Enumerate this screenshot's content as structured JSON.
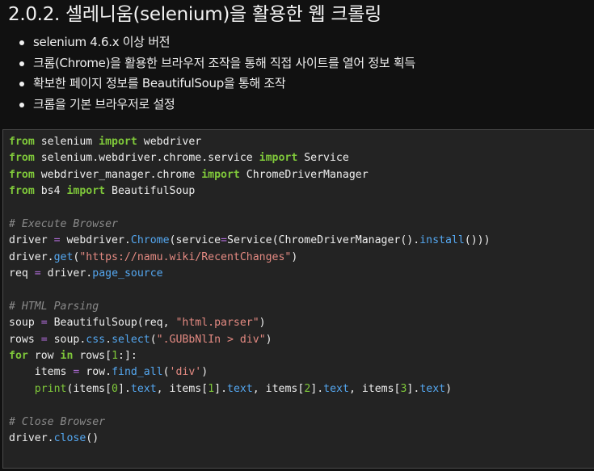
{
  "section": {
    "title": "2.0.2. 셀레니움(selenium)을 활용한 웹 크롤링"
  },
  "bullets": [
    "selenium 4.6.x 이상 버전",
    "크롬(Chrome)을 활용한 브라우저 조작을 통해 직접 사이트를 열어 정보 획득",
    "확보한 페이지 정보를 BeautifulSoup을 통해 조작",
    "크롬을 기본 브라우저로 설정"
  ],
  "code": {
    "language": "python",
    "colors": {
      "background": "#232323",
      "keyword": "#7fc83a",
      "comment": "#8a8a8a",
      "string": "#e48a82",
      "attribute": "#54a7f0",
      "operator": "#b06cd8"
    },
    "lines": [
      [
        {
          "t": "from",
          "c": "kw"
        },
        {
          "t": " selenium "
        },
        {
          "t": "import",
          "c": "kw"
        },
        {
          "t": " webdriver"
        }
      ],
      [
        {
          "t": "from",
          "c": "kw"
        },
        {
          "t": " selenium.webdriver.chrome.service "
        },
        {
          "t": "import",
          "c": "kw"
        },
        {
          "t": " Service"
        }
      ],
      [
        {
          "t": "from",
          "c": "kw"
        },
        {
          "t": " webdriver_manager.chrome "
        },
        {
          "t": "import",
          "c": "kw"
        },
        {
          "t": " ChromeDriverManager"
        }
      ],
      [
        {
          "t": "from",
          "c": "kw"
        },
        {
          "t": " bs4 "
        },
        {
          "t": "import",
          "c": "kw"
        },
        {
          "t": " BeautifulSoup"
        }
      ],
      [],
      [
        {
          "t": "# Execute Browser",
          "c": "cm"
        }
      ],
      [
        {
          "t": "driver "
        },
        {
          "t": "=",
          "c": "op"
        },
        {
          "t": " webdriver."
        },
        {
          "t": "Chrome",
          "c": "at"
        },
        {
          "t": "(service"
        },
        {
          "t": "=",
          "c": "op"
        },
        {
          "t": "Service(ChromeDriverManager()."
        },
        {
          "t": "install",
          "c": "at"
        },
        {
          "t": "()))"
        }
      ],
      [
        {
          "t": "driver."
        },
        {
          "t": "get",
          "c": "at"
        },
        {
          "t": "("
        },
        {
          "t": "\"https://namu.wiki/RecentChanges\"",
          "c": "st"
        },
        {
          "t": ")"
        }
      ],
      [
        {
          "t": "req "
        },
        {
          "t": "=",
          "c": "op"
        },
        {
          "t": " driver."
        },
        {
          "t": "page_source",
          "c": "at"
        }
      ],
      [],
      [
        {
          "t": "# HTML Parsing",
          "c": "cm"
        }
      ],
      [
        {
          "t": "soup "
        },
        {
          "t": "=",
          "c": "op"
        },
        {
          "t": " BeautifulSoup(req, "
        },
        {
          "t": "\"html.parser\"",
          "c": "st"
        },
        {
          "t": ")"
        }
      ],
      [
        {
          "t": "rows "
        },
        {
          "t": "=",
          "c": "op"
        },
        {
          "t": " soup."
        },
        {
          "t": "css",
          "c": "at"
        },
        {
          "t": "."
        },
        {
          "t": "select",
          "c": "at"
        },
        {
          "t": "("
        },
        {
          "t": "\".GUBbNlIn > div\"",
          "c": "st"
        },
        {
          "t": ")"
        }
      ],
      [
        {
          "t": "for",
          "c": "kw"
        },
        {
          "t": " row "
        },
        {
          "t": "in",
          "c": "kw"
        },
        {
          "t": " rows["
        },
        {
          "t": "1",
          "c": "nm"
        },
        {
          "t": ":]:"
        }
      ],
      [
        {
          "t": "    items "
        },
        {
          "t": "=",
          "c": "op"
        },
        {
          "t": " row."
        },
        {
          "t": "find_all",
          "c": "at"
        },
        {
          "t": "("
        },
        {
          "t": "'div'",
          "c": "st"
        },
        {
          "t": ")"
        }
      ],
      [
        {
          "t": "    "
        },
        {
          "t": "print",
          "c": "bi"
        },
        {
          "t": "(items["
        },
        {
          "t": "0",
          "c": "nm"
        },
        {
          "t": "]."
        },
        {
          "t": "text",
          "c": "at"
        },
        {
          "t": ", items["
        },
        {
          "t": "1",
          "c": "nm"
        },
        {
          "t": "]."
        },
        {
          "t": "text",
          "c": "at"
        },
        {
          "t": ", items["
        },
        {
          "t": "2",
          "c": "nm"
        },
        {
          "t": "]."
        },
        {
          "t": "text",
          "c": "at"
        },
        {
          "t": ", items["
        },
        {
          "t": "3",
          "c": "nm"
        },
        {
          "t": "]."
        },
        {
          "t": "text",
          "c": "at"
        },
        {
          "t": ")"
        }
      ],
      [],
      [
        {
          "t": "# Close Browser",
          "c": "cm"
        }
      ],
      [
        {
          "t": "driver."
        },
        {
          "t": "close",
          "c": "at"
        },
        {
          "t": "()"
        }
      ]
    ]
  }
}
